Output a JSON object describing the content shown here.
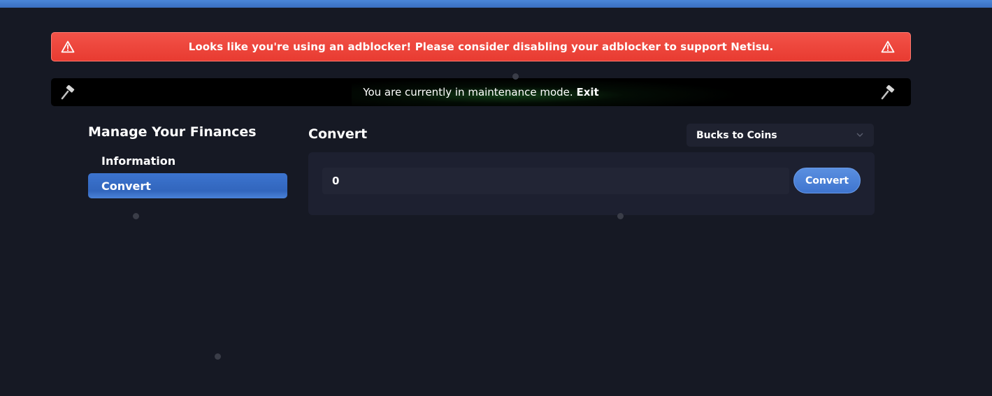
{
  "alert": {
    "message": "Looks like you're using an adblocker! Please consider disabling your adblocker to support Netisu.",
    "icon": "warning-icon",
    "color": "#f0433a"
  },
  "maintenance": {
    "message": "You are currently in maintenance mode.",
    "exit_label": "Exit",
    "icon": "hammer-icon"
  },
  "sidebar": {
    "title": "Manage Your Finances",
    "items": [
      {
        "label": "Information",
        "active": false
      },
      {
        "label": "Convert",
        "active": true
      }
    ]
  },
  "main": {
    "title": "Convert",
    "select": {
      "value": "Bucks to Coins"
    },
    "amount": {
      "value": "0"
    },
    "convert_label": "Convert"
  },
  "colors": {
    "background": "#161924",
    "accent": "#3c74cf",
    "panel": "#1d2030"
  }
}
